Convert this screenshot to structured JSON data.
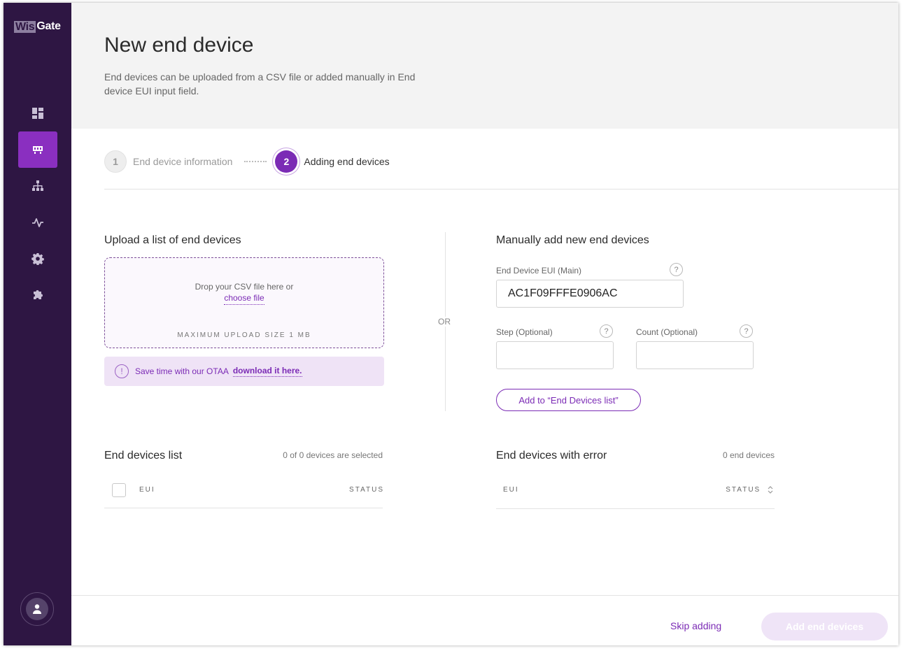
{
  "app": {
    "logo_part1": "Wis",
    "logo_part2": "Gate"
  },
  "sidebar": {
    "items": [
      {
        "name": "dashboard",
        "icon": "dashboard-icon",
        "active": false
      },
      {
        "name": "gateways",
        "icon": "gateway-icon",
        "active": true
      },
      {
        "name": "network",
        "icon": "network-icon",
        "active": false
      },
      {
        "name": "activity",
        "icon": "activity-icon",
        "active": false
      },
      {
        "name": "settings",
        "icon": "gear-icon",
        "active": false
      },
      {
        "name": "extensions",
        "icon": "puzzle-icon",
        "active": false
      }
    ],
    "user_icon": "user-icon"
  },
  "header": {
    "title": "New end device",
    "description": "End devices can be uploaded from a CSV file or added manually in End device EUI input field."
  },
  "stepper": {
    "steps": [
      {
        "number": "1",
        "label": "End device information",
        "state": "inactive"
      },
      {
        "number": "2",
        "label": "Adding end devices",
        "state": "active"
      }
    ]
  },
  "upload": {
    "title": "Upload a list of end devices",
    "drop_text": "Drop your CSV file here or",
    "choose_file": "choose file",
    "max_size": "MAXIMUM UPLOAD SIZE 1 MB",
    "note_text": "Save time with our OTAA",
    "note_link": "download it here.",
    "note_icon": "!"
  },
  "divider": {
    "or": "OR"
  },
  "manual": {
    "title": "Manually add new end devices",
    "eui_label": "End Device EUI (Main)",
    "eui_value": "AC1F09FFFE0906AC",
    "step_label": "Step (Optional)",
    "step_value": "",
    "count_label": "Count (Optional)",
    "count_value": "",
    "help": "?",
    "add_button": "Add to “End Devices list”"
  },
  "end_devices_list": {
    "title": "End devices list",
    "count": "0 of 0 devices are selected",
    "col_eui": "EUI",
    "col_status": "STATUS"
  },
  "error_list": {
    "title": "End devices with error",
    "count": "0 end devices",
    "col_eui": "EUI",
    "col_status": "STATUS"
  },
  "footer": {
    "skip": "Skip adding",
    "submit": "Add end devices"
  },
  "colors": {
    "sidebar": "#2e1643",
    "accent": "#7b2bb5",
    "active_nav": "#8a2fc0",
    "disabled_button": "#efe4f7"
  }
}
